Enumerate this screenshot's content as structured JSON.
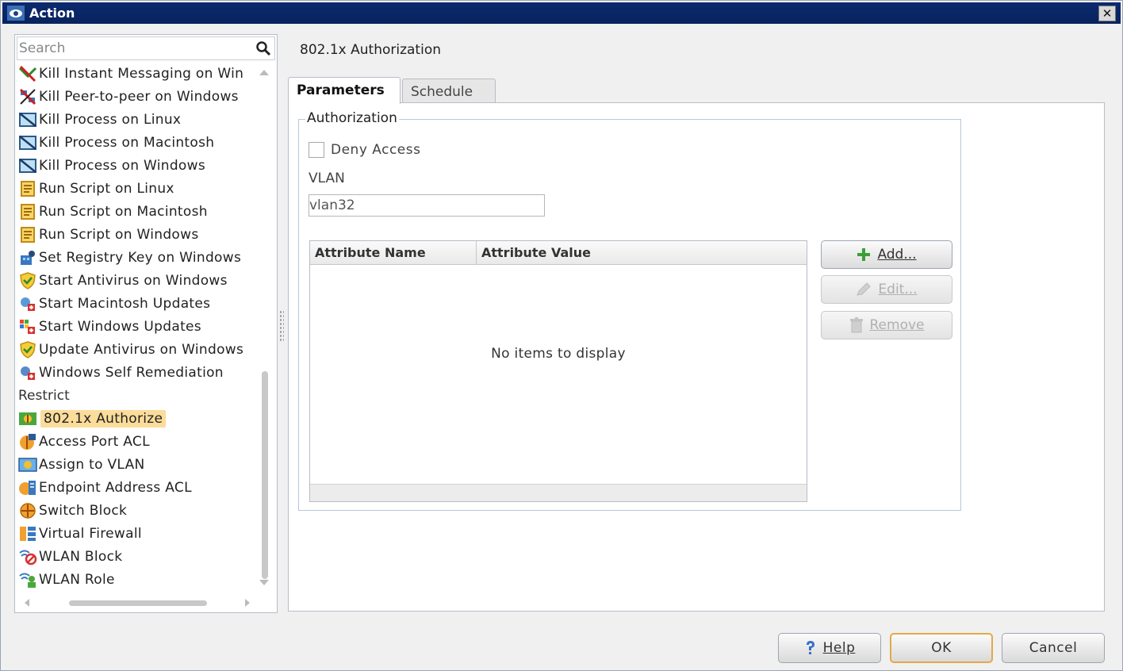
{
  "window": {
    "title": "Action",
    "close_label": "✕"
  },
  "search": {
    "placeholder": "Search"
  },
  "list": {
    "items": [
      {
        "label": "Kill Instant Messaging on Win",
        "icon": "kill-im-icon"
      },
      {
        "label": "Kill Peer-to-peer on Windows",
        "icon": "kill-p2p-icon"
      },
      {
        "label": "Kill Process on Linux",
        "icon": "kill-process-icon"
      },
      {
        "label": "Kill Process on Macintosh",
        "icon": "kill-process-icon"
      },
      {
        "label": "Kill Process on Windows",
        "icon": "kill-process-icon"
      },
      {
        "label": "Run Script on Linux",
        "icon": "script-icon"
      },
      {
        "label": "Run Script on Macintosh",
        "icon": "script-icon"
      },
      {
        "label": "Run Script on Windows",
        "icon": "script-icon"
      },
      {
        "label": "Set Registry Key on Windows",
        "icon": "registry-icon"
      },
      {
        "label": "Start Antivirus on Windows",
        "icon": "antivirus-icon"
      },
      {
        "label": "Start Macintosh Updates",
        "icon": "updates-icon"
      },
      {
        "label": "Start Windows Updates",
        "icon": "updates-icon"
      },
      {
        "label": "Update Antivirus on Windows",
        "icon": "antivirus-icon"
      },
      {
        "label": "Windows Self Remediation",
        "icon": "remediation-icon"
      }
    ],
    "group_label": "Restrict",
    "restrict_items": [
      {
        "label": "802.1x Authorize",
        "icon": "authorize-icon",
        "selected": true
      },
      {
        "label": "Access Port ACL",
        "icon": "acl-icon"
      },
      {
        "label": "Assign to VLAN",
        "icon": "vlan-icon"
      },
      {
        "label": "Endpoint Address ACL",
        "icon": "endpoint-acl-icon"
      },
      {
        "label": "Switch Block",
        "icon": "switch-block-icon"
      },
      {
        "label": "Virtual Firewall",
        "icon": "firewall-icon"
      },
      {
        "label": "WLAN Block",
        "icon": "wlan-block-icon"
      },
      {
        "label": "WLAN Role",
        "icon": "wlan-role-icon"
      }
    ]
  },
  "panel": {
    "title": "802.1x Authorization",
    "tabs": [
      {
        "label": "Parameters"
      },
      {
        "label": "Schedule"
      }
    ],
    "group_title": "Authorization",
    "deny_access_label": "Deny Access",
    "vlan_label": "VLAN",
    "vlan_value": "vlan32",
    "table": {
      "columns": [
        "Attribute Name",
        "Attribute Value"
      ],
      "empty_text": "No items to display"
    },
    "buttons": {
      "add": "Add...",
      "edit": "Edit...",
      "remove": "Remove"
    }
  },
  "footer": {
    "help": "Help",
    "ok": "OK",
    "cancel": "Cancel"
  },
  "colors": {
    "titlebar": "#0b2a6e",
    "selection": "#fbdc9a",
    "ok_border": "#e3a94a"
  }
}
